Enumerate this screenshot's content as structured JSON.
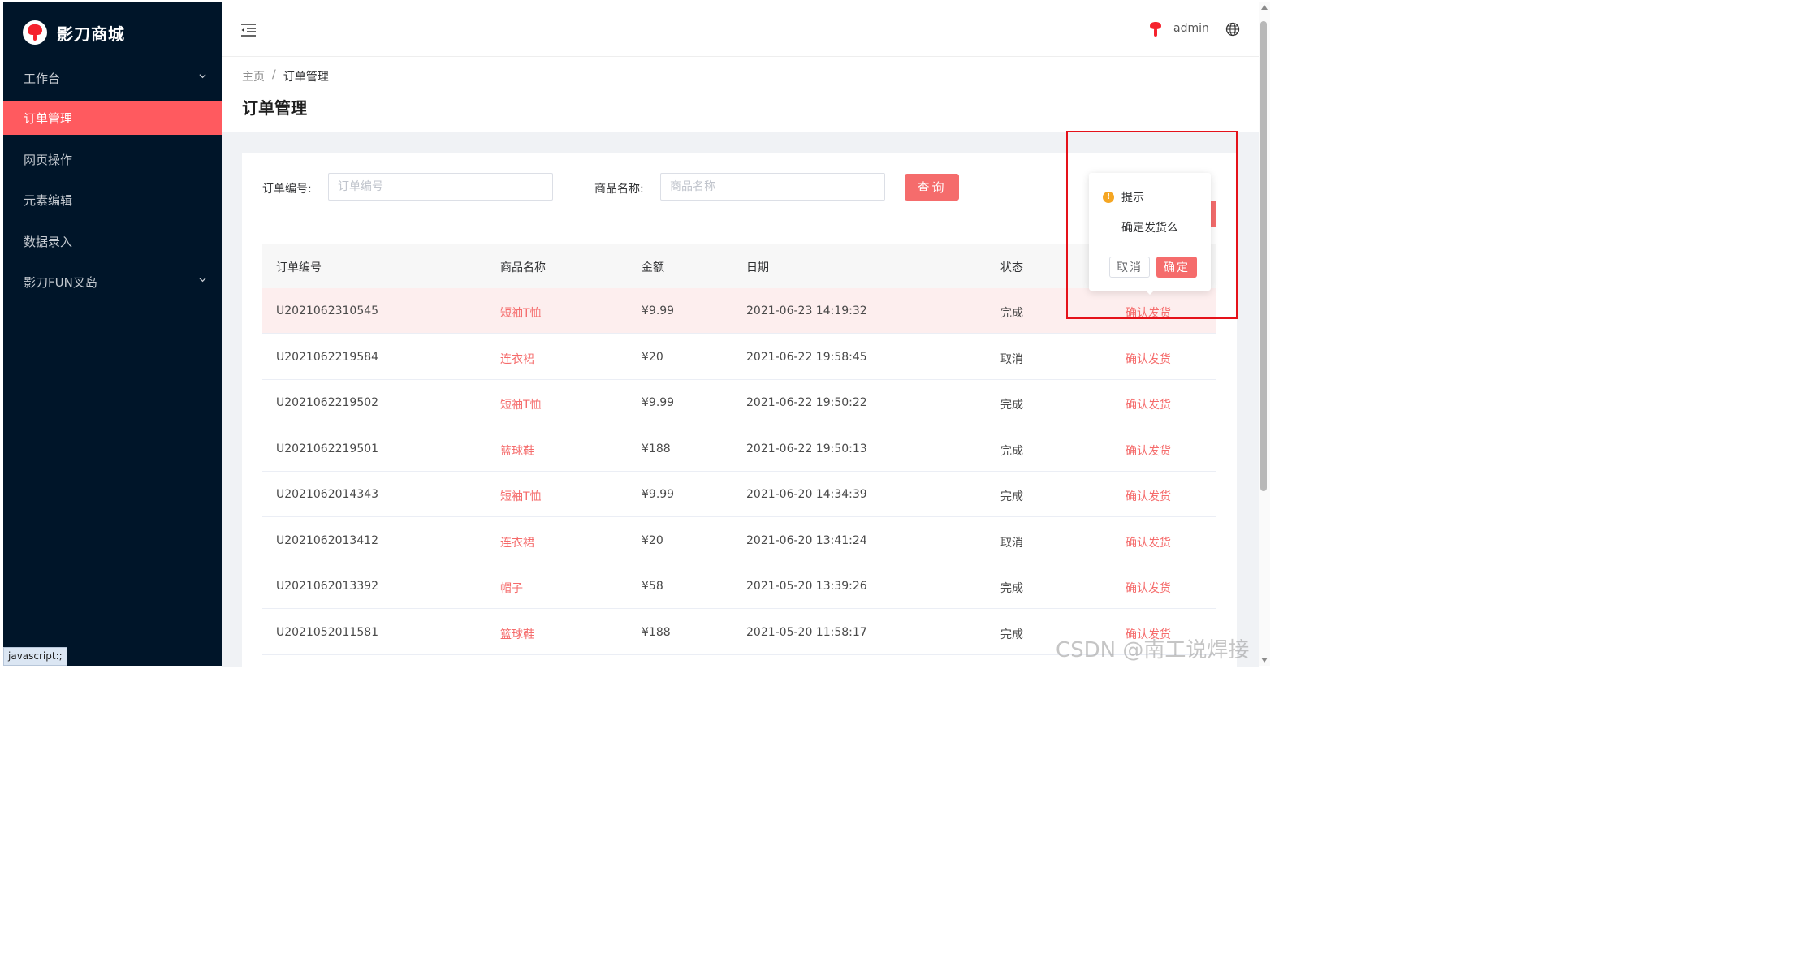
{
  "brand": {
    "name": "影刀商城",
    "accent": "#f56c6c",
    "sidebar_bg": "#001529",
    "active_menu_bg": "#ff5a5f"
  },
  "sidebar": {
    "items": [
      {
        "label": "工作台",
        "has_submenu": true,
        "active": false
      },
      {
        "label": "订单管理",
        "has_submenu": false,
        "active": true
      },
      {
        "label": "网页操作",
        "has_submenu": false,
        "active": false
      },
      {
        "label": "元素编辑",
        "has_submenu": false,
        "active": false
      },
      {
        "label": "数据录入",
        "has_submenu": false,
        "active": false
      },
      {
        "label": "影刀FUN叉岛",
        "has_submenu": true,
        "active": false
      }
    ]
  },
  "header": {
    "username": "admin",
    "icons": [
      "menu-fold-icon",
      "brand-icon",
      "globe-icon"
    ]
  },
  "breadcrumb": {
    "home": "主页",
    "separator": "/",
    "current": "订单管理"
  },
  "page_title": "订单管理",
  "search": {
    "order_no_label": "订单编号:",
    "order_no_placeholder": "订单编号",
    "order_no_value": "",
    "product_label": "商品名称:",
    "product_placeholder": "商品名称",
    "product_value": "",
    "query_button": "查询"
  },
  "table": {
    "columns": [
      "订单编号",
      "商品名称",
      "金额",
      "日期",
      "状态"
    ],
    "rows": [
      {
        "order_no": "U2021062310545",
        "product": "短袖T恤",
        "amount": "¥9.99",
        "date": "2021-06-23 14:19:32",
        "status": "完成",
        "action": "确认发货"
      },
      {
        "order_no": "U2021062219584",
        "product": "连衣裙",
        "amount": "¥20",
        "date": "2021-06-22 19:58:45",
        "status": "取消",
        "action": "确认发货"
      },
      {
        "order_no": "U2021062219502",
        "product": "短袖T恤",
        "amount": "¥9.99",
        "date": "2021-06-22 19:50:22",
        "status": "完成",
        "action": "确认发货"
      },
      {
        "order_no": "U2021062219501",
        "product": "篮球鞋",
        "amount": "¥188",
        "date": "2021-06-22 19:50:13",
        "status": "完成",
        "action": "确认发货"
      },
      {
        "order_no": "U2021062014343",
        "product": "短袖T恤",
        "amount": "¥9.99",
        "date": "2021-06-20 14:34:39",
        "status": "完成",
        "action": "确认发货"
      },
      {
        "order_no": "U2021062013412",
        "product": "连衣裙",
        "amount": "¥20",
        "date": "2021-06-20 13:41:24",
        "status": "取消",
        "action": "确认发货"
      },
      {
        "order_no": "U2021062013392",
        "product": "帽子",
        "amount": "¥58",
        "date": "2021-05-20 13:39:26",
        "status": "完成",
        "action": "确认发货"
      },
      {
        "order_no": "U2021052011581",
        "product": "篮球鞋",
        "amount": "¥188",
        "date": "2021-05-20 11:58:17",
        "status": "完成",
        "action": "确认发货"
      }
    ]
  },
  "popconfirm": {
    "title": "提示",
    "message": "确定发货么",
    "cancel": "取消",
    "confirm": "确定",
    "icon": "warning-icon"
  },
  "status_bar": "javascript:;",
  "watermark": "CSDN @南工说焊接"
}
